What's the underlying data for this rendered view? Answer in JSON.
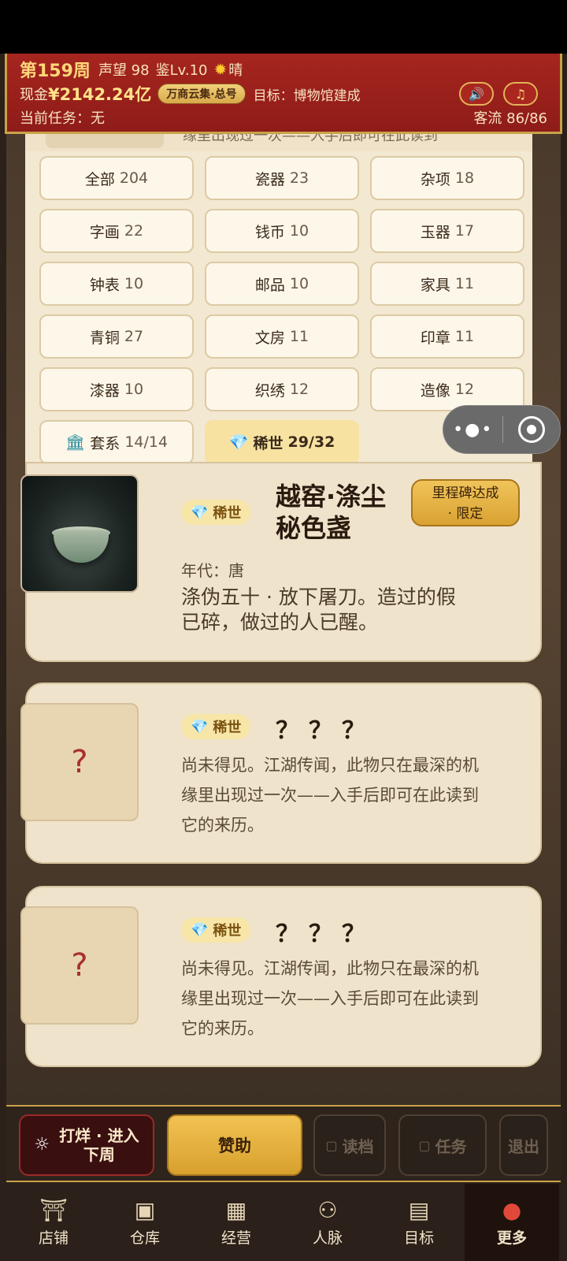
{
  "header": {
    "week": "第159周",
    "reputation": "声望 98",
    "appraisal": "鉴Lv.10",
    "weather_icon": "sun-icon",
    "weather": "晴",
    "cash_label": "现金",
    "cash_value": "¥2142.24亿",
    "badge": "万商云集·总号",
    "target": "目标：博物馆建成",
    "current_task": "当前任务：无",
    "traffic": "客流 86/86",
    "sound_icon": "speaker-icon",
    "music_icon": "music-note-icon"
  },
  "peek": {
    "text": "缘里出现过一次——入手后即可在此读到"
  },
  "filters": [
    {
      "label": "全部",
      "count": "204"
    },
    {
      "label": "瓷器",
      "count": "23"
    },
    {
      "label": "杂项",
      "count": "18"
    },
    {
      "label": "字画",
      "count": "22"
    },
    {
      "label": "钱币",
      "count": "10"
    },
    {
      "label": "玉器",
      "count": "17"
    },
    {
      "label": "钟表",
      "count": "10"
    },
    {
      "label": "邮品",
      "count": "10"
    },
    {
      "label": "家具",
      "count": "11"
    },
    {
      "label": "青铜",
      "count": "27"
    },
    {
      "label": "文房",
      "count": "11"
    },
    {
      "label": "印章",
      "count": "11"
    },
    {
      "label": "漆器",
      "count": "10"
    },
    {
      "label": "织绣",
      "count": "12"
    },
    {
      "label": "造像",
      "count": "12"
    },
    {
      "label": "套系",
      "count": "14/14",
      "icon": "museum-icon"
    },
    {
      "label": "稀世",
      "count": "29/32",
      "icon": "diamond-icon",
      "active": true
    }
  ],
  "cards": [
    {
      "rarity": "稀世",
      "title_line1": "越窑·涤尘",
      "title_line2": "秘色盏",
      "milestone_line1": "里程碑达成",
      "milestone_line2": "· 限定",
      "era": "年代：唐",
      "desc_line1": "涤伪五十 · 放下屠刀。造过的假",
      "desc_line2": "已碎，做过的人已醒。"
    },
    {
      "rarity": "稀世",
      "title": "？？？",
      "placeholder": "?",
      "desc_line1": "尚未得见。江湖传闻，此物只在最深的机",
      "desc_line2": "缘里出现过一次——入手后即可在此读到",
      "desc_line3": "它的来历。"
    },
    {
      "rarity": "稀世",
      "title": "？？？",
      "placeholder": "?",
      "desc_line1": "尚未得见。江湖传闻，此物只在最深的机",
      "desc_line2": "缘里出现过一次——入手后即可在此读到",
      "desc_line3": "它的来历。"
    }
  ],
  "actions": {
    "close_line1": "打烊 · 进入",
    "close_line2": "下周",
    "support": "赞助",
    "load": "读档",
    "task": "任务",
    "exit": "退出"
  },
  "tabs": [
    {
      "label": "店铺",
      "icon": "shop-icon"
    },
    {
      "label": "仓库",
      "icon": "warehouse-icon"
    },
    {
      "label": "经营",
      "icon": "abacus-icon"
    },
    {
      "label": "人脉",
      "icon": "people-icon"
    },
    {
      "label": "目标",
      "icon": "scroll-icon"
    },
    {
      "label": "更多",
      "icon": "more-icon",
      "active": true
    }
  ]
}
